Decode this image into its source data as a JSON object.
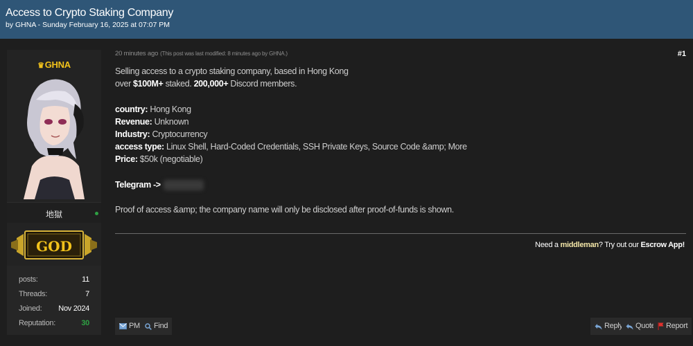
{
  "thread": {
    "title": "Access to Crypto Staking Company",
    "meta": "by GHNA - Sunday February 16, 2025 at 07:07 PM"
  },
  "author": {
    "username": "GHNA",
    "usertitle": "地獄",
    "rank": "GOD",
    "stats": [
      {
        "label": "posts:",
        "value": "11"
      },
      {
        "label": "Threads:",
        "value": "7"
      },
      {
        "label": "Joined:",
        "value": "Nov 2024"
      },
      {
        "label": "Reputation:",
        "value": "30"
      }
    ]
  },
  "post": {
    "date": "20 minutes ago",
    "edited": "(This post was last modified: 8 minutes ago by GHNA.)",
    "number": "#1",
    "lines": {
      "l1": "Selling access to a crypto staking company, based in Hong Kong",
      "l2a": "over ",
      "l2b": "$100M+",
      "l2c": " staked. ",
      "l2d": "200,000+",
      "l2e": " Discord members.",
      "country_label": "country:",
      "country_value": " Hong Kong",
      "revenue_label": "Revenue:",
      "revenue_value": " Unknown",
      "industry_label": "Industry:",
      "industry_value": " Cryptocurrency",
      "access_label": "access type:",
      "access_value": " Linux Shell, Hard-Coded Credentials, SSH Private Keys, Source Code &amp; More",
      "price_label": "Price:",
      "price_value": " $50k (negotiable)",
      "telegram_label": "Telegram ->",
      "proof": "Proof of access &amp; the company name will only be disclosed after proof-of-funds is shown."
    },
    "signature": {
      "a": "Need a ",
      "b": "middleman",
      "c": "? Try out our ",
      "d": "Escrow App!"
    }
  },
  "buttons": {
    "pm": "PM",
    "find": "Find",
    "reply": "Reply",
    "quote": "Quote",
    "report": "Report"
  },
  "colors": {
    "header": "#2f5677",
    "username": "#f2c21b",
    "reputation": "#2ea043",
    "report_flag": "#e0302c"
  }
}
